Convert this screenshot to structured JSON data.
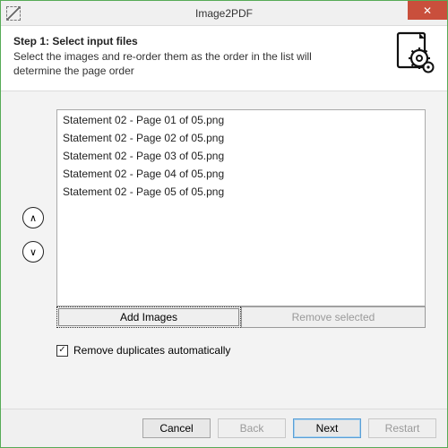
{
  "window": {
    "title": "Image2PDF"
  },
  "header": {
    "step_title": "Step 1: Select input files",
    "description": "Select the images and re-order them as the order in the list will determine the page order"
  },
  "files": {
    "items": [
      "Statement 02 - Page 01 of 05.png",
      "Statement 02 - Page 02 of 05.png",
      "Statement 02 - Page 03 of 05.png",
      "Statement 02 - Page 04 of 05.png",
      "Statement 02 - Page 05 of 05.png"
    ]
  },
  "buttons": {
    "add_images": "Add Images",
    "remove_selected": "Remove selected"
  },
  "options": {
    "remove_duplicates_label": "Remove duplicates automatically",
    "remove_duplicates_checked": true
  },
  "footer": {
    "cancel": "Cancel",
    "back": "Back",
    "next": "Next",
    "restart": "Restart"
  },
  "icons": {
    "close": "✕",
    "up": "∧",
    "down": "∨",
    "check": "✓"
  }
}
